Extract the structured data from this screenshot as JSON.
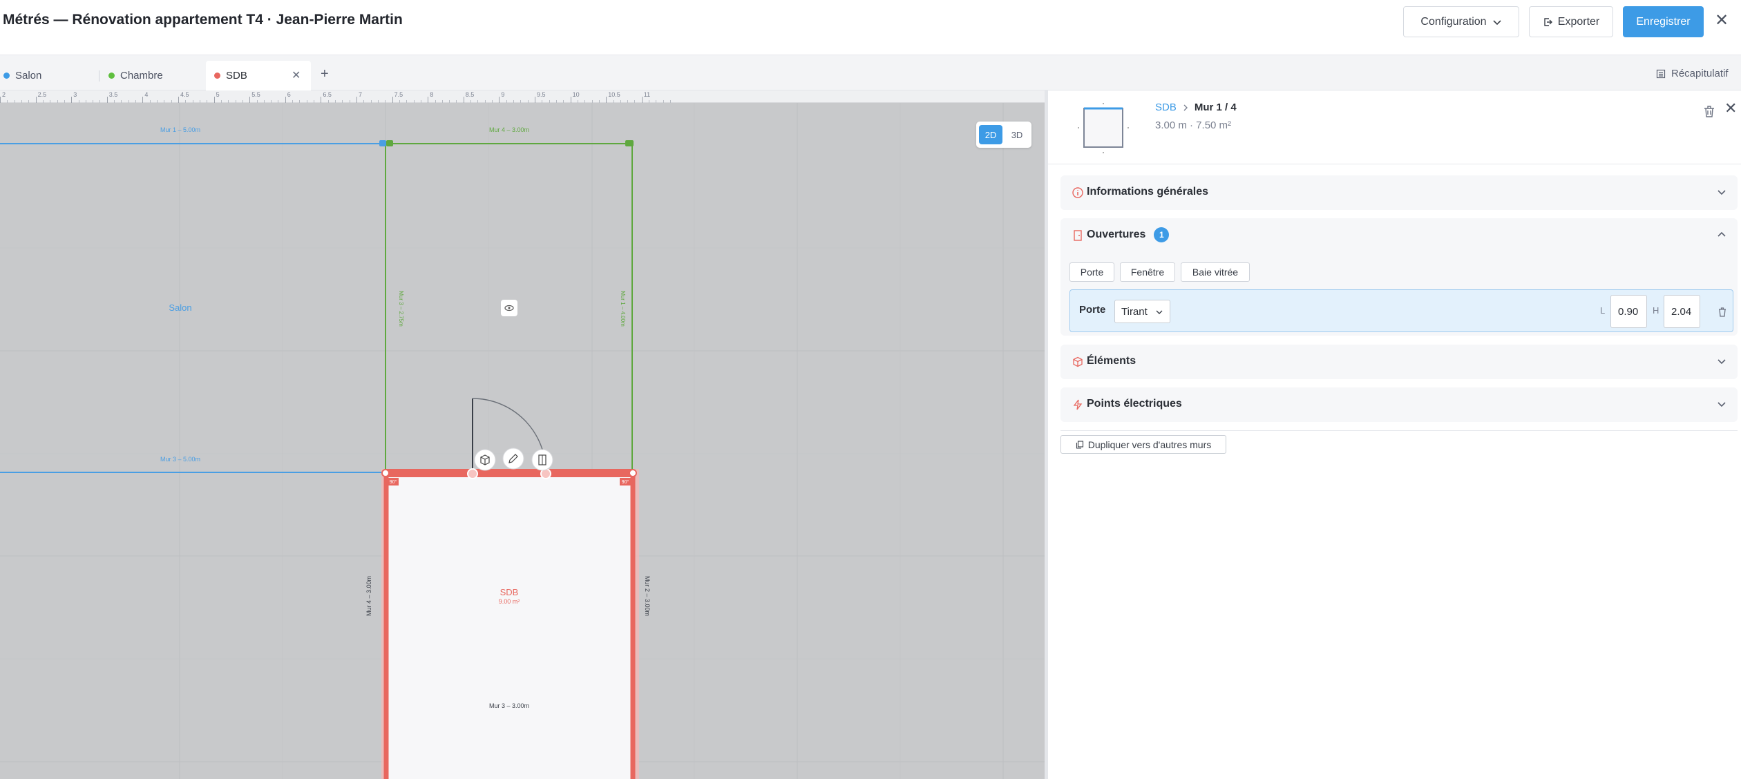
{
  "header": {
    "title": "Métrés — Rénovation appartement T4 · Jean-Pierre Martin",
    "config_label": "Configuration",
    "export_label": "Exporter",
    "save_label": "Enregistrer"
  },
  "tabs": {
    "items": [
      {
        "label": "Salon",
        "color": "#3d9be6"
      },
      {
        "label": "Chambre",
        "color": "#5fbf3f"
      },
      {
        "label": "SDB",
        "color": "#e8675f"
      }
    ],
    "recap_label": "Récapitulatif"
  },
  "canvas": {
    "ruler_ticks": [
      "2",
      "2.5",
      "3",
      "3.5",
      "4",
      "4.5",
      "5",
      "5.5",
      "6",
      "6.5",
      "7",
      "7.5",
      "8",
      "8.5",
      "9",
      "9.5",
      "10",
      "10.5",
      "11"
    ],
    "view_modes": [
      "2D",
      "3D"
    ],
    "active_view": "2D",
    "salon": {
      "name": "Salon",
      "mur1": "Mur 1 – 5.00m",
      "mur3": "Mur 3 – 5.00m",
      "color": "#3d9be6"
    },
    "chambre": {
      "mur4": "Mur 4 – 3.00m",
      "mur_left": "Mur 3 – 2.75m",
      "mur_right": "Mur 1 – 4.00m",
      "color": "#5fbf3f"
    },
    "sdb": {
      "name": "SDB",
      "area": "9.00 m²",
      "mur2": "Mur 2 – 3.00m",
      "mur3": "Mur 3 – 3.00m",
      "mur4": "Mur 4 – 3.00m",
      "angle": "90°",
      "color": "#e8675f"
    }
  },
  "panel": {
    "breadcrumb_room": "SDB",
    "breadcrumb_wall": "Mur 1 / 4",
    "meta": "3.00 m · 7.50 m²",
    "sections": {
      "info": "Informations générales",
      "openings": "Ouvertures",
      "openings_count": "1",
      "elements": "Éléments",
      "electric": "Points électriques"
    },
    "opening_types": [
      "Porte",
      "Fenêtre",
      "Baie vitrée"
    ],
    "opening": {
      "label": "Porte",
      "type_value": "Tirant",
      "l_label": "L",
      "l_value": "0.90",
      "h_label": "H",
      "h_value": "2.04"
    },
    "duplicate_label": "Dupliquer vers d'autres murs"
  }
}
